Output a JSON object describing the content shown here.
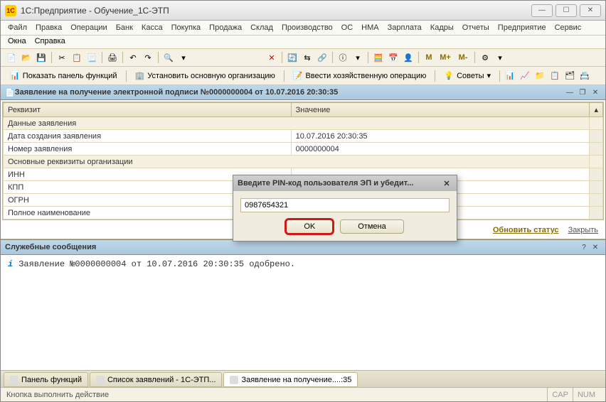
{
  "window": {
    "title": "1С:Предприятие - Обучение_1С-ЭТП",
    "icon_text": "1C"
  },
  "menu": {
    "row1": [
      "Файл",
      "Правка",
      "Операции",
      "Банк",
      "Касса",
      "Покупка",
      "Продажа",
      "Склад",
      "Производство",
      "ОС",
      "НМА",
      "Зарплата",
      "Кадры",
      "Отчеты",
      "Предприятие",
      "Сервис"
    ],
    "row2": [
      "Окна",
      "Справка"
    ]
  },
  "toolbar2": {
    "show_panel": "Показать панель функций",
    "set_org": "Установить основную организацию",
    "enter_op": "Ввести хозяйственную операцию",
    "tips": "Советы",
    "m": "M",
    "m_plus": "M+",
    "m_minus": "M-"
  },
  "doc": {
    "title": "Заявление на получение электронной подписи №0000000004 от 10.07.2016 20:30:35",
    "col_requisite": "Реквизит",
    "col_value": "Значение",
    "rows": [
      {
        "r": "Данные заявления",
        "v": "",
        "group": true
      },
      {
        "r": "Дата создания заявления",
        "v": "10.07.2016 20:30:35"
      },
      {
        "r": "Номер заявления",
        "v": "0000000004"
      },
      {
        "r": "Основные реквизиты организации",
        "v": "",
        "group": true
      },
      {
        "r": "ИНН",
        "v": ""
      },
      {
        "r": "КПП",
        "v": ""
      },
      {
        "r": "ОГРН",
        "v": ""
      },
      {
        "r": "Полное наименование",
        "v": ""
      }
    ],
    "update_status": "Обновить статус",
    "close": "Закрыть"
  },
  "messages": {
    "header": "Служебные сообщения",
    "text": "Заявление №0000000004 от 10.07.2016 20:30:35 одобрено."
  },
  "tabs": {
    "t1": "Панель функций",
    "t2": "Список заявлений - 1С-ЭТП...",
    "t3": "Заявление на получение....:35"
  },
  "status": {
    "text": "Кнопка выполнить действие",
    "cap": "CAP",
    "num": "NUM"
  },
  "modal": {
    "title": "Введите PIN-код пользователя ЭП и убедит...",
    "value": "0987654321",
    "ok": "OK",
    "cancel": "Отмена"
  }
}
